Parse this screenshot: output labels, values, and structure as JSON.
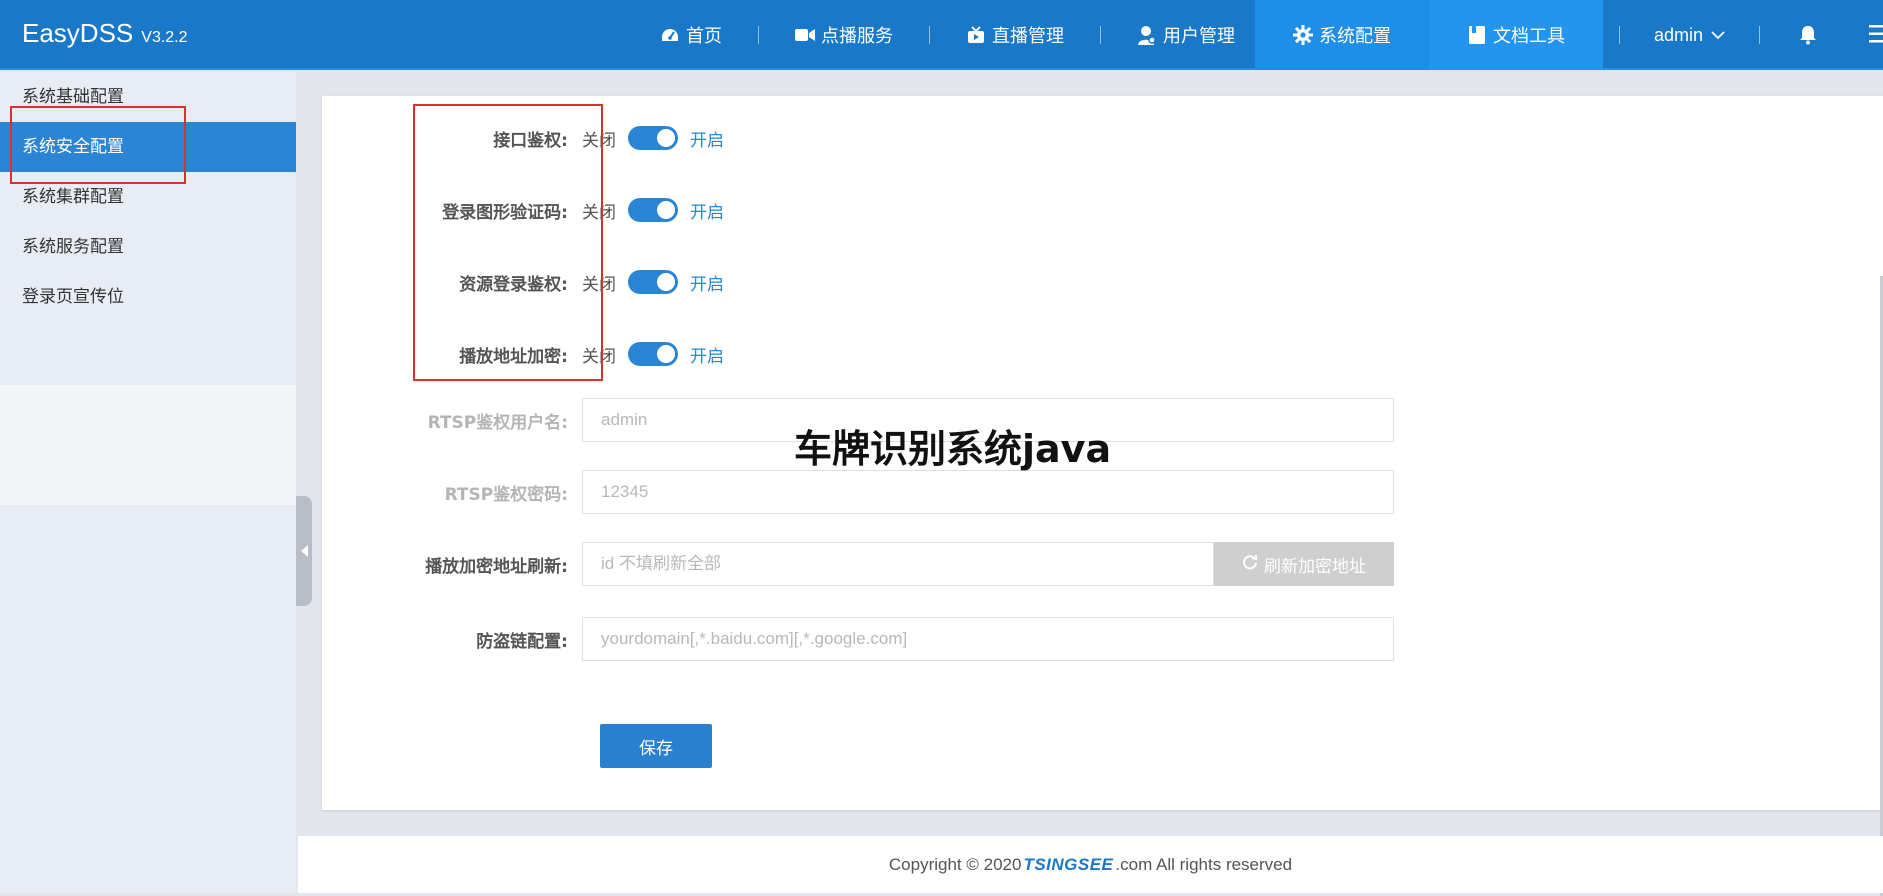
{
  "brand": {
    "name": "EasyDSS",
    "version": "V3.2.2"
  },
  "nav": {
    "items": [
      {
        "label": "首页",
        "icon": "dashboard-icon"
      },
      {
        "label": "点播服务",
        "icon": "video-camera-icon"
      },
      {
        "label": "直播管理",
        "icon": "tv-icon"
      },
      {
        "label": "用户管理",
        "icon": "user-icon"
      },
      {
        "label": "系统配置",
        "icon": "gear-icon"
      },
      {
        "label": "文档工具",
        "icon": "book-icon"
      }
    ],
    "user": "admin"
  },
  "sidebar": {
    "items": [
      {
        "label": "系统基础配置"
      },
      {
        "label": "系统安全配置"
      },
      {
        "label": "系统集群配置"
      },
      {
        "label": "系统服务配置"
      },
      {
        "label": "登录页宣传位"
      }
    ],
    "active_index": 1
  },
  "form": {
    "toggles": [
      {
        "label": "接口鉴权:",
        "off": "关闭",
        "on": "开启",
        "enabled": true
      },
      {
        "label": "登录图形验证码:",
        "off": "关闭",
        "on": "开启",
        "enabled": true
      },
      {
        "label": "资源登录鉴权:",
        "off": "关闭",
        "on": "开启",
        "enabled": true
      },
      {
        "label": "播放地址加密:",
        "off": "关闭",
        "on": "开启",
        "enabled": true
      }
    ],
    "rtsp_user": {
      "label": "RTSP鉴权用户名:",
      "value": "admin"
    },
    "rtsp_pass": {
      "label": "RTSP鉴权密码:",
      "value": "12345"
    },
    "refresh": {
      "label": "播放加密地址刷新:",
      "placeholder": "id 不填刷新全部",
      "button": "刷新加密地址"
    },
    "hotlink": {
      "label": "防盗链配置:",
      "placeholder": "yourdomain[,*.baidu.com][,*.google.com]"
    },
    "save": "保存"
  },
  "watermark": "车牌识别系统java",
  "footer": {
    "prefix": "Copyright © 2020 ",
    "logo": "TSINGSEE",
    "suffix": ".com All rights reserved"
  },
  "colors": {
    "topbar": "#1a78c9",
    "accent": "#2a85d6",
    "highlight_box": "#d9312f"
  }
}
